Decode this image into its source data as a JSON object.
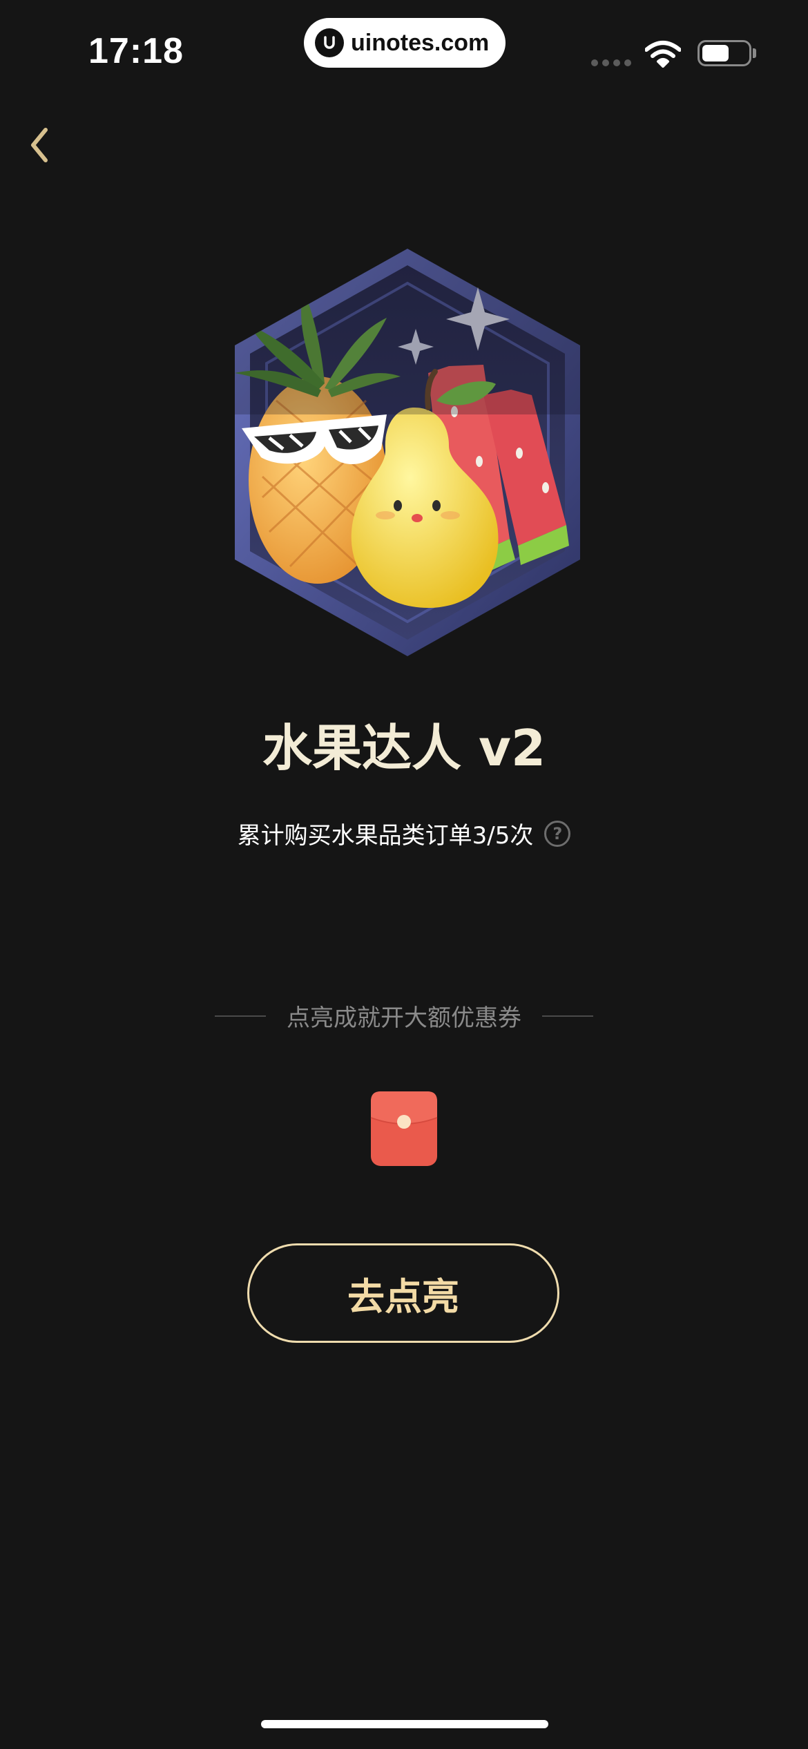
{
  "status_bar": {
    "time": "17:18",
    "watermark": "uinotes.com",
    "icons": [
      "signal-icon",
      "wifi-icon",
      "battery-icon"
    ]
  },
  "nav": {
    "back_icon": "chevron-left-icon"
  },
  "achievement": {
    "title": "水果达人 v2",
    "progress_text": "累计购买水果品类订单3/5次",
    "progress": {
      "current": 3,
      "total": 5
    },
    "help_label": "?",
    "reward_hint": "点亮成就开大额优惠券",
    "reward_icon": "red-envelope-icon",
    "cta_label": "去点亮"
  },
  "colors": {
    "background": "#151515",
    "title": "#f3ecd6",
    "accent_gold": "#efdcae",
    "envelope_red": "#ea5a4c"
  }
}
